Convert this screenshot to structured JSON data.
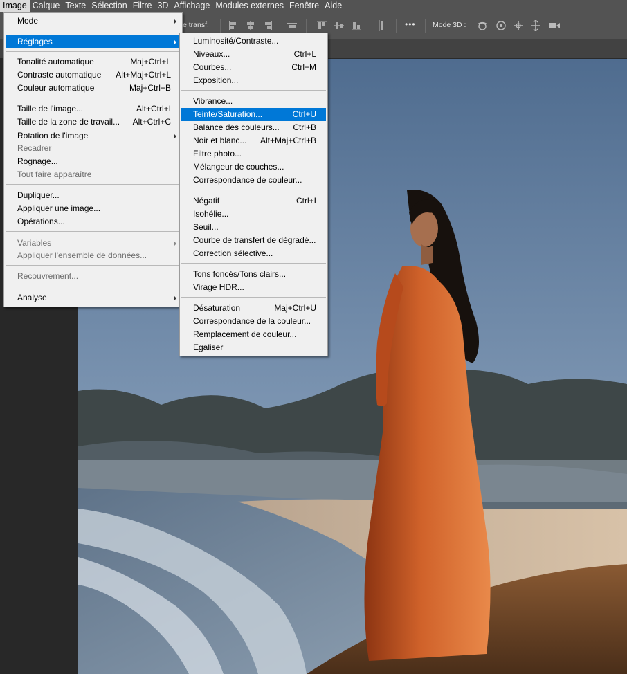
{
  "menubar": {
    "items": [
      "Image",
      "Calque",
      "Texte",
      "Sélection",
      "Filtre",
      "3D",
      "Affichage",
      "Modules externes",
      "Fenêtre",
      "Aide"
    ],
    "active": "Image"
  },
  "optionsbar": {
    "transform_label": "e transf.",
    "mode3d_label": "Mode 3D :",
    "more_label": "•••"
  },
  "image_menu": {
    "items": [
      {
        "label": "Mode",
        "submenu": true
      },
      {
        "label": "Réglages",
        "submenu": true,
        "highlighted": true
      },
      {
        "label": "Tonalité automatique",
        "shortcut": "Maj+Ctrl+L"
      },
      {
        "label": "Contraste automatique",
        "shortcut": "Alt+Maj+Ctrl+L"
      },
      {
        "label": "Couleur automatique",
        "shortcut": "Maj+Ctrl+B"
      },
      {
        "label": "Taille de l'image...",
        "shortcut": "Alt+Ctrl+I"
      },
      {
        "label": "Taille de la zone de travail...",
        "shortcut": "Alt+Ctrl+C"
      },
      {
        "label": "Rotation de l'image",
        "submenu": true
      },
      {
        "label": "Recadrer",
        "disabled": true
      },
      {
        "label": "Rognage..."
      },
      {
        "label": "Tout faire apparaître",
        "disabled": true
      },
      {
        "label": "Dupliquer..."
      },
      {
        "label": "Appliquer une image..."
      },
      {
        "label": "Opérations..."
      },
      {
        "label": "Variables",
        "submenu": true,
        "disabled": true
      },
      {
        "label": "Appliquer l'ensemble de données...",
        "disabled": true
      },
      {
        "label": "Recouvrement...",
        "disabled": true
      },
      {
        "label": "Analyse",
        "submenu": true
      }
    ]
  },
  "reglages_menu": {
    "items": [
      {
        "label": "Luminosité/Contraste..."
      },
      {
        "label": "Niveaux...",
        "shortcut": "Ctrl+L"
      },
      {
        "label": "Courbes...",
        "shortcut": "Ctrl+M"
      },
      {
        "label": "Exposition..."
      },
      {
        "label": "Vibrance..."
      },
      {
        "label": "Teinte/Saturation...",
        "shortcut": "Ctrl+U",
        "highlighted": true
      },
      {
        "label": "Balance des couleurs...",
        "shortcut": "Ctrl+B"
      },
      {
        "label": "Noir et blanc...",
        "shortcut": "Alt+Maj+Ctrl+B"
      },
      {
        "label": "Filtre photo..."
      },
      {
        "label": "Mélangeur de couches..."
      },
      {
        "label": "Correspondance de couleur..."
      },
      {
        "label": "Négatif",
        "shortcut": "Ctrl+I"
      },
      {
        "label": "Isohélie..."
      },
      {
        "label": "Seuil..."
      },
      {
        "label": "Courbe de transfert de dégradé..."
      },
      {
        "label": "Correction sélective..."
      },
      {
        "label": "Tons foncés/Tons clairs..."
      },
      {
        "label": "Virage HDR..."
      },
      {
        "label": "Désaturation",
        "shortcut": "Maj+Ctrl+U"
      },
      {
        "label": "Correspondance de la couleur..."
      },
      {
        "label": "Remplacement de couleur..."
      },
      {
        "label": "Egaliser"
      }
    ]
  },
  "colors": {
    "highlight": "#0078d7",
    "menu_bg": "#f0f0f0",
    "chrome": "#535353",
    "dress": "#c4551f"
  }
}
